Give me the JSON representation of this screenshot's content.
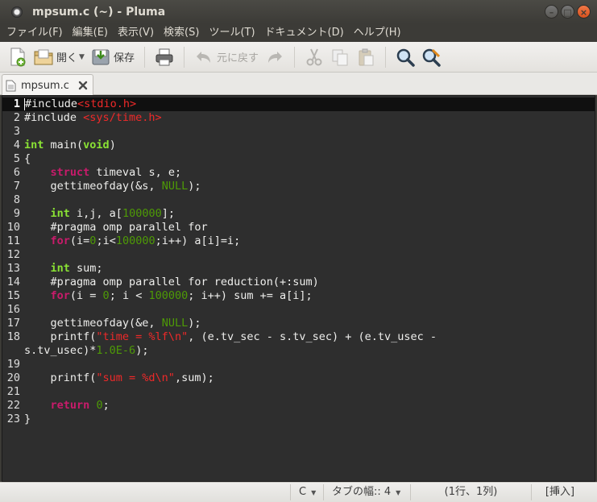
{
  "window": {
    "title": "mpsum.c (~) - Pluma",
    "buttons": {
      "minimize": "–",
      "maximize": "□",
      "close": "×"
    }
  },
  "menu": [
    "ファイル(F)",
    "編集(E)",
    "表示(V)",
    "検索(S)",
    "ツール(T)",
    "ドキュメント(D)",
    "ヘルプ(H)"
  ],
  "toolbar": {
    "open_label": "開く",
    "save_label": "保存",
    "undo_label": "元に戻す"
  },
  "tab": {
    "label": "mpsum.c"
  },
  "colors": {
    "editor_bg": "#2e2e2e",
    "type_keyword": "#8ae234",
    "flow_keyword": "#c91b6b",
    "string": "#ef2929",
    "number": "#4e9a06"
  },
  "editor": {
    "current_line": 1,
    "lines": [
      {
        "n": "1",
        "parts": [
          [
            "t",
            "#include"
          ],
          [
            "s",
            "<stdio.h>"
          ]
        ]
      },
      {
        "n": "2",
        "parts": [
          [
            "t",
            "#include "
          ],
          [
            "s",
            "<sys/time.h>"
          ]
        ]
      },
      {
        "n": "3",
        "parts": []
      },
      {
        "n": "4",
        "parts": [
          [
            "k",
            "int"
          ],
          [
            "t",
            " main("
          ],
          [
            "k",
            "void"
          ],
          [
            "t",
            ")"
          ]
        ]
      },
      {
        "n": "5",
        "parts": [
          [
            "t",
            "{"
          ]
        ]
      },
      {
        "n": "6",
        "parts": [
          [
            "t",
            "    "
          ],
          [
            "f",
            "struct"
          ],
          [
            "t",
            " timeval s, e;"
          ]
        ]
      },
      {
        "n": "7",
        "parts": [
          [
            "t",
            "    gettimeofday(&s, "
          ],
          [
            "c",
            "NULL"
          ],
          [
            "t",
            ");"
          ]
        ]
      },
      {
        "n": "8",
        "parts": []
      },
      {
        "n": "9",
        "parts": [
          [
            "t",
            "    "
          ],
          [
            "k",
            "int"
          ],
          [
            "t",
            " i,j, a["
          ],
          [
            "n",
            "100000"
          ],
          [
            "t",
            "];"
          ]
        ]
      },
      {
        "n": "10",
        "parts": [
          [
            "t",
            "    #pragma omp parallel for"
          ]
        ]
      },
      {
        "n": "11",
        "parts": [
          [
            "t",
            "    "
          ],
          [
            "f",
            "for"
          ],
          [
            "t",
            "(i="
          ],
          [
            "n",
            "0"
          ],
          [
            "t",
            ";i<"
          ],
          [
            "n",
            "100000"
          ],
          [
            "t",
            ";i++) a[i]=i;"
          ]
        ]
      },
      {
        "n": "12",
        "parts": []
      },
      {
        "n": "13",
        "parts": [
          [
            "t",
            "    "
          ],
          [
            "k",
            "int"
          ],
          [
            "t",
            " sum;"
          ]
        ]
      },
      {
        "n": "14",
        "parts": [
          [
            "t",
            "    #pragma omp parallel for reduction(+:sum)"
          ]
        ]
      },
      {
        "n": "15",
        "parts": [
          [
            "t",
            "    "
          ],
          [
            "f",
            "for"
          ],
          [
            "t",
            "(i = "
          ],
          [
            "n",
            "0"
          ],
          [
            "t",
            "; i < "
          ],
          [
            "n",
            "100000"
          ],
          [
            "t",
            "; i++) sum += a[i];"
          ]
        ]
      },
      {
        "n": "16",
        "parts": []
      },
      {
        "n": "17",
        "parts": [
          [
            "t",
            "    gettimeofday(&e, "
          ],
          [
            "c",
            "NULL"
          ],
          [
            "t",
            ");"
          ]
        ]
      },
      {
        "n": "18",
        "parts": [
          [
            "t",
            "    printf("
          ],
          [
            "s",
            "\"time = %lf\\n\""
          ],
          [
            "t",
            ", (e.tv_sec - s.tv_sec) + (e.tv_usec -"
          ]
        ]
      },
      {
        "n": "",
        "parts": [
          [
            "t",
            "s.tv_usec)*"
          ],
          [
            "n",
            "1.0E-6"
          ],
          [
            "t",
            ");"
          ]
        ]
      },
      {
        "n": "19",
        "parts": []
      },
      {
        "n": "20",
        "parts": [
          [
            "t",
            "    printf("
          ],
          [
            "s",
            "\"sum = %d\\n\""
          ],
          [
            "t",
            ",sum);"
          ]
        ]
      },
      {
        "n": "21",
        "parts": []
      },
      {
        "n": "22",
        "parts": [
          [
            "t",
            "    "
          ],
          [
            "f",
            "return"
          ],
          [
            "t",
            " "
          ],
          [
            "n",
            "0"
          ],
          [
            "t",
            ";"
          ]
        ]
      },
      {
        "n": "23",
        "parts": [
          [
            "t",
            "}"
          ]
        ]
      }
    ]
  },
  "statusbar": {
    "language": "C",
    "tab_width": "タブの幅:: 4",
    "position": "(1行、1列)",
    "mode": "[挿入]"
  }
}
